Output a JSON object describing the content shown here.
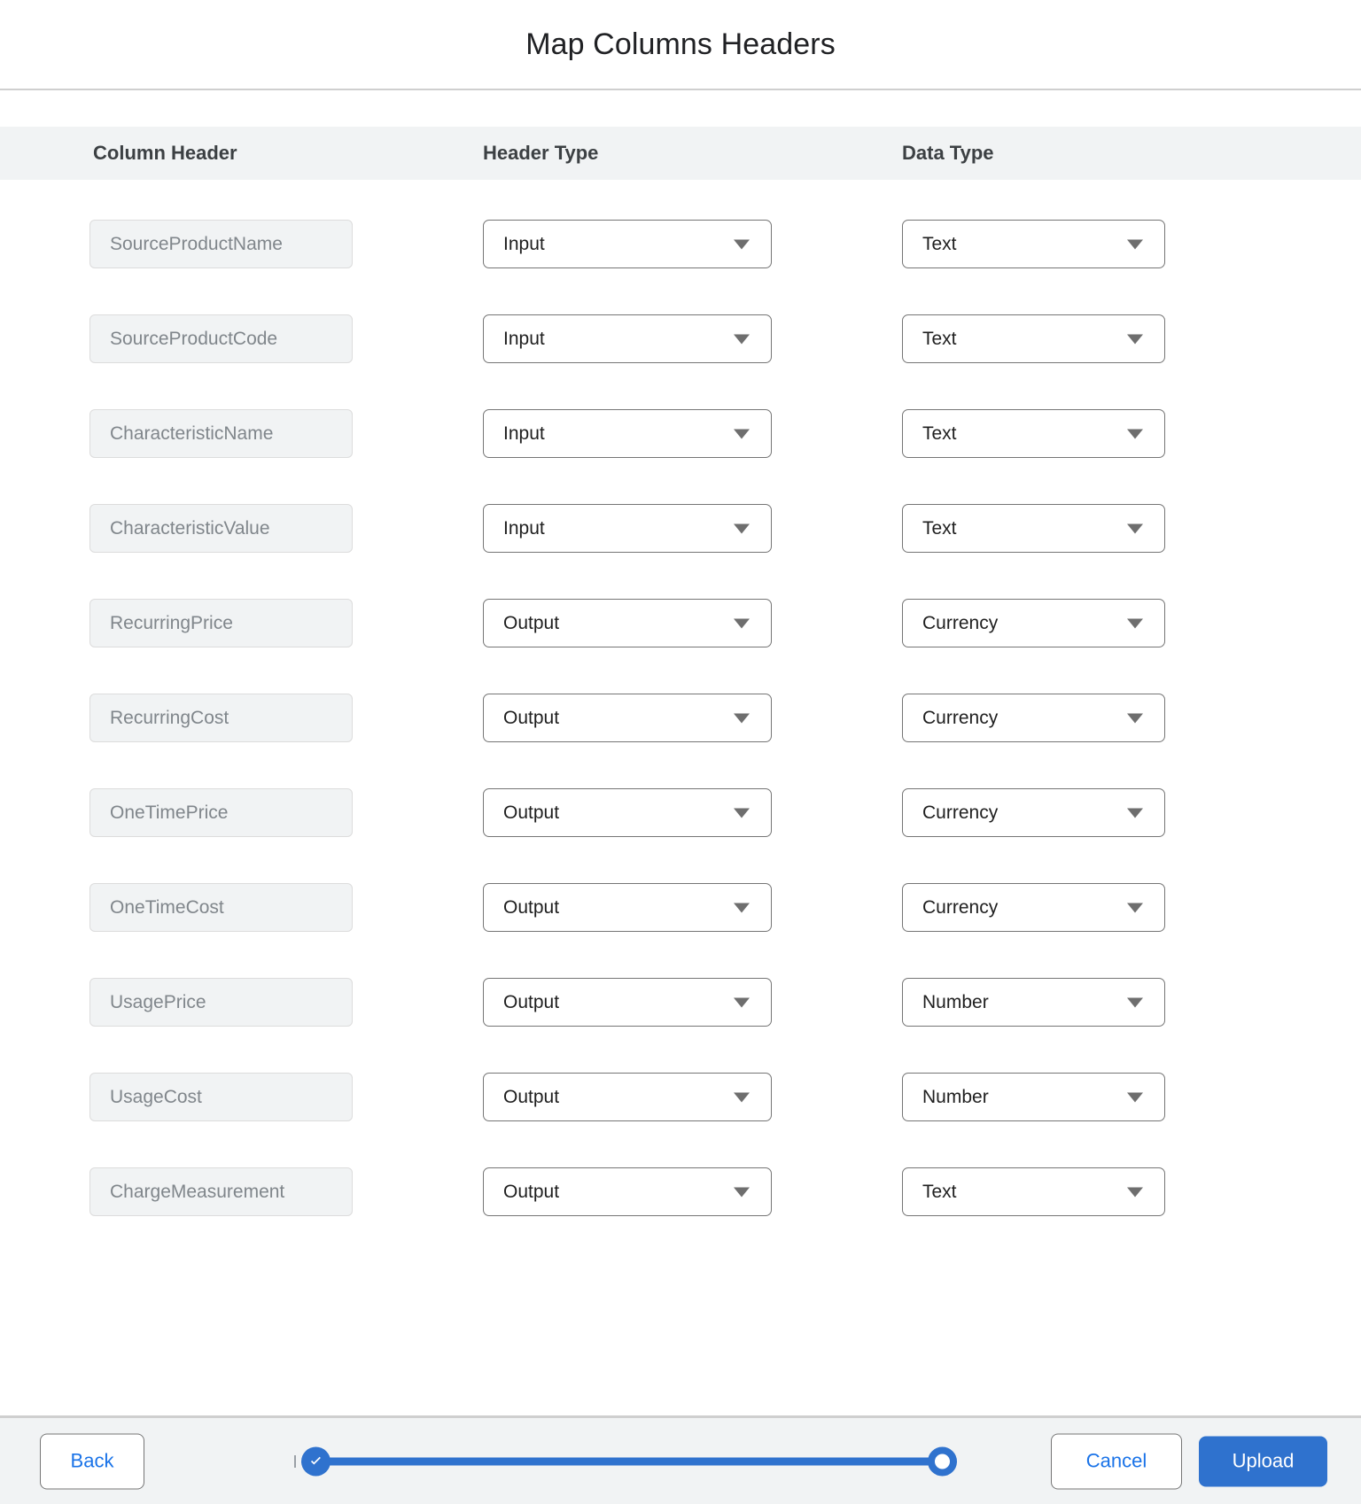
{
  "dialog": {
    "title": "Map Columns Headers"
  },
  "table": {
    "columns": [
      {
        "label": "Column Header"
      },
      {
        "label": "Header Type"
      },
      {
        "label": "Data Type"
      }
    ],
    "rows": [
      {
        "column_header": "SourceProductName",
        "header_type": "Input",
        "data_type": "Text"
      },
      {
        "column_header": "SourceProductCode",
        "header_type": "Input",
        "data_type": "Text"
      },
      {
        "column_header": "CharacteristicName",
        "header_type": "Input",
        "data_type": "Text"
      },
      {
        "column_header": "CharacteristicValue",
        "header_type": "Input",
        "data_type": "Text"
      },
      {
        "column_header": "RecurringPrice",
        "header_type": "Output",
        "data_type": "Currency"
      },
      {
        "column_header": "RecurringCost",
        "header_type": "Output",
        "data_type": "Currency"
      },
      {
        "column_header": "OneTimePrice",
        "header_type": "Output",
        "data_type": "Currency"
      },
      {
        "column_header": "OneTimeCost",
        "header_type": "Output",
        "data_type": "Currency"
      },
      {
        "column_header": "UsagePrice",
        "header_type": "Output",
        "data_type": "Number"
      },
      {
        "column_header": "UsageCost",
        "header_type": "Output",
        "data_type": "Number"
      },
      {
        "column_header": "ChargeMeasurement",
        "header_type": "Output",
        "data_type": "Text"
      }
    ]
  },
  "footer": {
    "back_label": "Back",
    "cancel_label": "Cancel",
    "upload_label": "Upload",
    "stepper": {
      "completed_icon": "check-circle-icon",
      "current_icon": "ring-circle-icon"
    }
  },
  "colors": {
    "accent": "#2f72ce",
    "link": "#1a73e8",
    "field_bg": "#f1f3f4",
    "border": "#757575",
    "muted_text": "#80868b"
  }
}
